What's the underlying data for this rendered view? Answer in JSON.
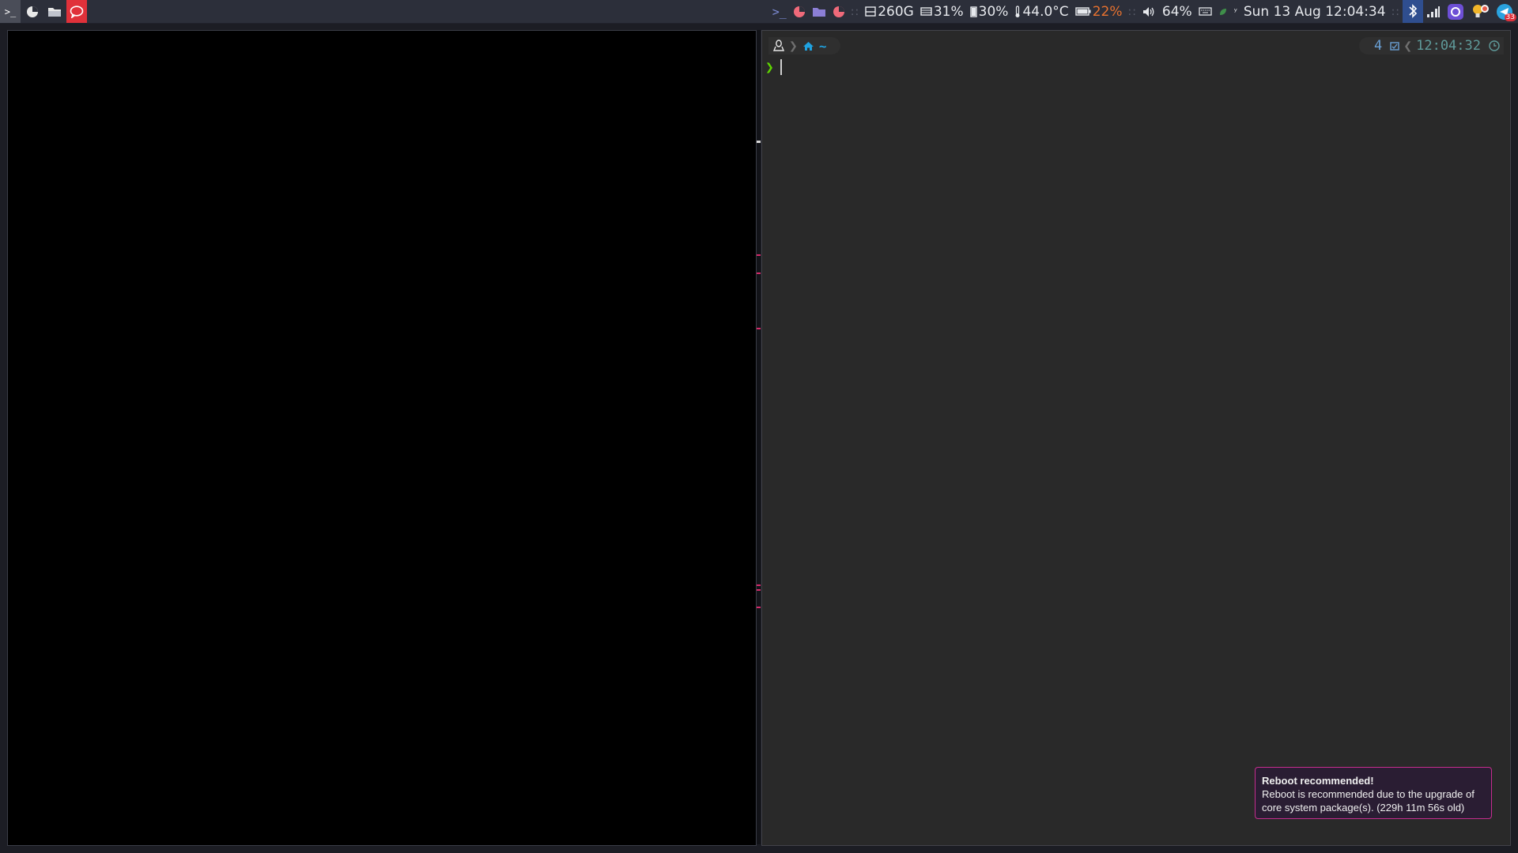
{
  "launchers": [
    {
      "name": "terminal",
      "icon": ">_"
    },
    {
      "name": "browser",
      "icon": "◕"
    },
    {
      "name": "file-manager",
      "icon": "▭"
    },
    {
      "name": "chat",
      "icon": "◯"
    }
  ],
  "tray": {
    "disk": "260G",
    "memory": "31%",
    "cpu": "30%",
    "temperature": "44.0°C",
    "battery": "22%",
    "volume": "64%",
    "datetime": "Sun 13 Aug 12:04:34",
    "separator": "::",
    "notification_count": "33"
  },
  "terminal": {
    "directory": "~",
    "jobs": "4",
    "time": "12:04:32",
    "prompt_char": "❯"
  },
  "notification": {
    "title": "Reboot recommended!",
    "body": "Reboot is recommended due to the upgrade of core system package(s). (229h 11m 56s old)"
  },
  "colors": {
    "accent": "#e0313a",
    "warning": "#e8722f",
    "prompt": "#5fd700",
    "directory": "#1fa2e0",
    "notification_border": "#c52d8e"
  }
}
